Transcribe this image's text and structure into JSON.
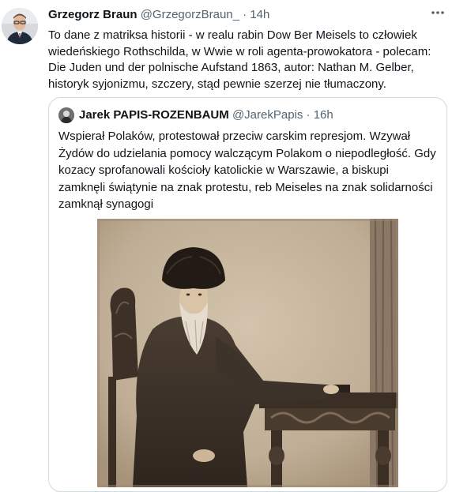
{
  "tweet": {
    "author_name": "Grzegorz Braun",
    "author_handle": "@GrzegorzBraun_",
    "separator": "·",
    "time": "14h",
    "text_lines": [
      "To dane z matriksa historii - w realu rabin Dow Ber Meisels to człowiek",
      "wiedeńskiego Rothschilda, w Wwie w roli agenta-prowokatora - polecam:",
      "Die Juden und der polnische Aufstand 1863, autor: Nathan M. Gelber,",
      "historyk syjonizmu, szczery, stąd pewnie szerzej nie tłumaczony."
    ]
  },
  "quoted": {
    "author_name": "Jarek PAPIS-ROZENBAUM",
    "author_handle": "@JarekPapis",
    "separator": "·",
    "time": "16h",
    "text_lines": [
      "Wspierał Polaków, protestował przeciw carskim represjom. Wzywał",
      "Żydów do udzielania pomocy walczącym Polakom o niepodległość. Gdy",
      "kozacy sprofanowali kościoły katolickie w Warszawie, a biskupi",
      "zamknęli świątynie na znak protestu, reb Meiseles na znak solidarności",
      "zamknął synagogi"
    ]
  },
  "icons": {
    "more": "more-horizontal-icon"
  },
  "colors": {
    "text": "#0f1419",
    "secondary": "#536471",
    "border": "#cfd9de",
    "sepia_dark": "#3a2f26",
    "sepia_light": "#c9b9a2"
  }
}
